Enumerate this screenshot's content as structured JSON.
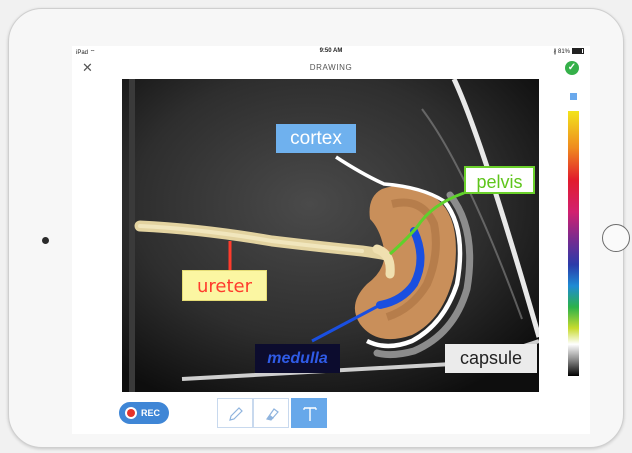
{
  "statusbar": {
    "device": "iPad",
    "wifi_icon": "wifi-icon",
    "time": "9:50 AM",
    "battery": "81%"
  },
  "nav": {
    "close": "✕",
    "title": "DRAWING",
    "done": "✓"
  },
  "labels": {
    "cortex": "cortex",
    "pelvis": "pelvis",
    "ureter": "ureter",
    "medulla": "medulla",
    "capsule": "capsule"
  },
  "colors": {
    "accent": "#3f86d6",
    "done": "#35b049",
    "cortex_label": "#6fb1ee",
    "pelvis_label": "#6bd12b",
    "ureter_label": "#ff3b2c",
    "medulla_label": "#2f5be6",
    "capsule_label": "#ebebeb"
  },
  "toolbar": {
    "rec_label": "REC",
    "tools": [
      "pencil-icon",
      "eraser-icon",
      "text-icon"
    ],
    "selected_tool": "text-icon"
  }
}
